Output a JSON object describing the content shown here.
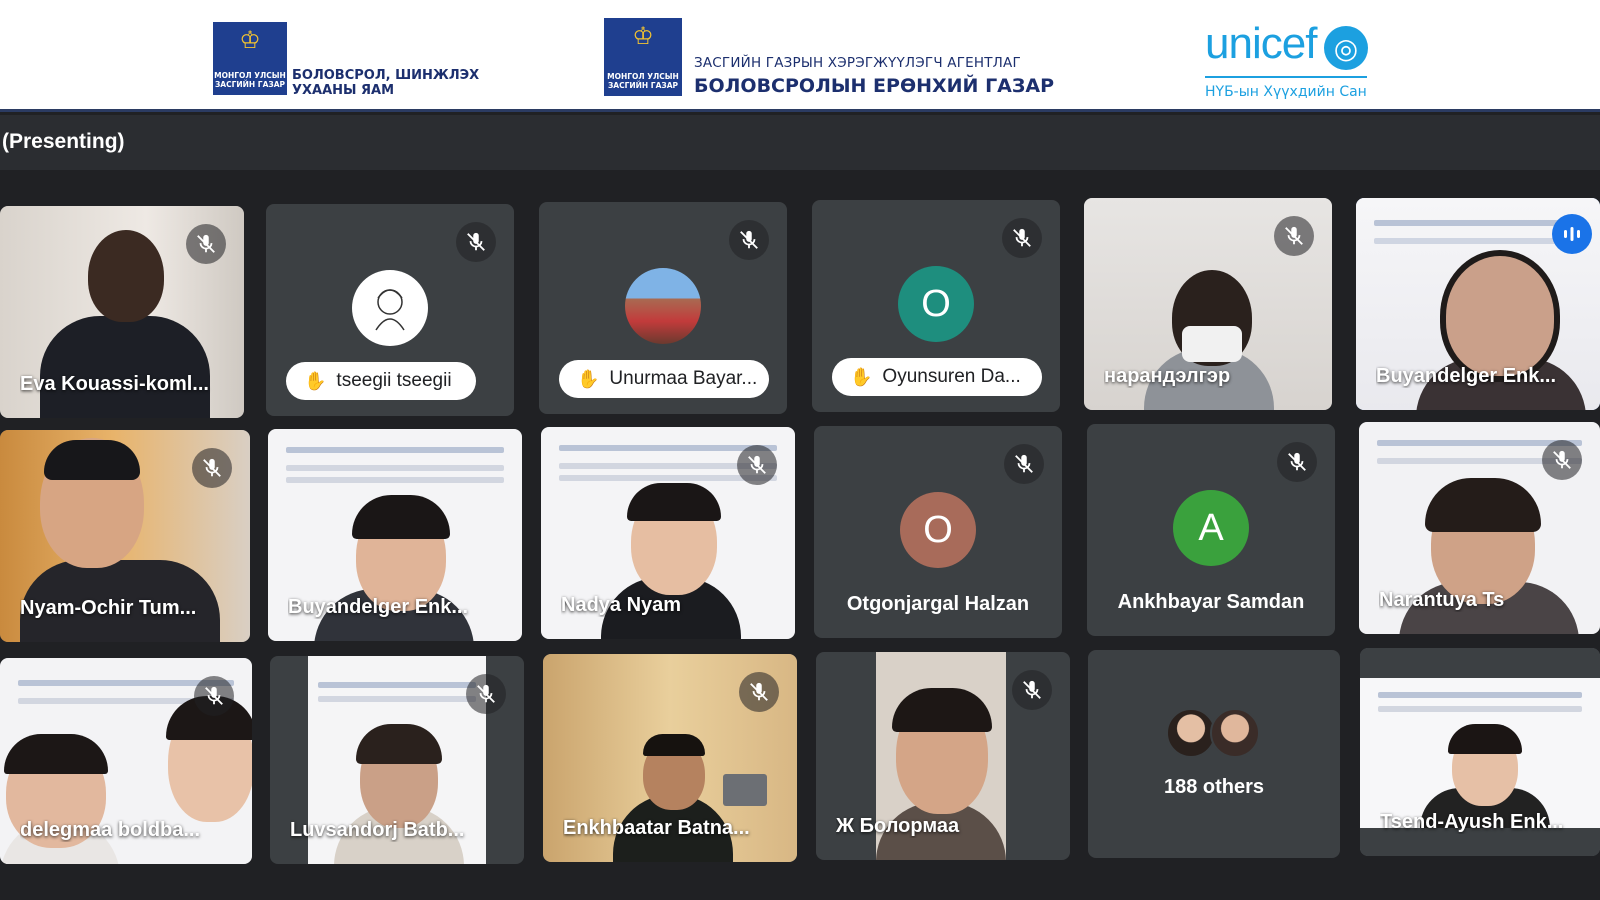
{
  "banner": {
    "emblem_text": "МОНГОЛ УЛСЫН ЗАСГИЙН ГАЗАР",
    "ministry_name": "БОЛОВСРОЛ, ШИНЖЛЭХ УХААНЫ ЯАМ",
    "agency_line1": "ЗАСГИЙН ГАЗРЫН ХЭРЭГЖҮҮЛЭГЧ АГЕНТЛАГ",
    "agency_line2": "БОЛОВСРОЛЫН ЕРӨНХИЙ ГАЗАР",
    "unicef_word": "unicef",
    "unicef_sub": "НҮБ-ын Хүүхдийн Сан"
  },
  "presenting": {
    "label": "(Presenting)"
  },
  "participants": [
    {
      "name": "Eva Kouassi-koml...",
      "type": "video",
      "muted": true
    },
    {
      "name": "tseegii tseegii",
      "type": "avatar-photo",
      "hand_raised": true,
      "muted": true
    },
    {
      "name": "Unurmaa Bayar...",
      "type": "avatar-photo",
      "hand_raised": true,
      "muted": true
    },
    {
      "name": "Oyunsuren Da...",
      "type": "avatar-letter",
      "letter": "O",
      "hand_raised": true,
      "muted": true
    },
    {
      "name": "нарандэлгэр",
      "type": "video",
      "muted": true
    },
    {
      "name": "Buyandelger Enk...",
      "type": "video",
      "speaking": true
    },
    {
      "name": "Nyam-Ochir Tum...",
      "type": "video",
      "muted": true
    },
    {
      "name": "Buyandelger Enk...",
      "type": "video"
    },
    {
      "name": "Nadya Nyam",
      "type": "video",
      "muted": true
    },
    {
      "name": "Otgonjargal Halzan",
      "type": "avatar-letter",
      "letter": "O",
      "muted": true
    },
    {
      "name": "Ankhbayar Samdan",
      "type": "avatar-letter",
      "letter": "A",
      "muted": true
    },
    {
      "name": "Narantuya Ts",
      "type": "video",
      "muted": true
    },
    {
      "name": "delegmaa boldba...",
      "type": "video",
      "muted": true
    },
    {
      "name": "Luvsandorj Batb...",
      "type": "video",
      "muted": true
    },
    {
      "name": "Enkhbaatar Batna...",
      "type": "video",
      "muted": true
    },
    {
      "name": "Ж Болормаа",
      "type": "video",
      "muted": true
    },
    {
      "name": "Tsend-Ayush Enk...",
      "type": "video"
    }
  ],
  "others": {
    "label": "188 others"
  },
  "colors": {
    "background": "#202124",
    "tile": "#3c4043",
    "avatar_teal": "#1e8e7e",
    "avatar_brown": "#a86b5a",
    "avatar_green": "#3aa13d",
    "speaking_blue": "#1a73e8",
    "unicef_blue": "#1ca0e0",
    "ministry_blue": "#1c2f6e"
  },
  "icons": [
    "mic-off-icon",
    "raised-hand-icon",
    "speaking-indicator-icon",
    "soyombo-emblem-icon",
    "unicef-globe-icon"
  ]
}
